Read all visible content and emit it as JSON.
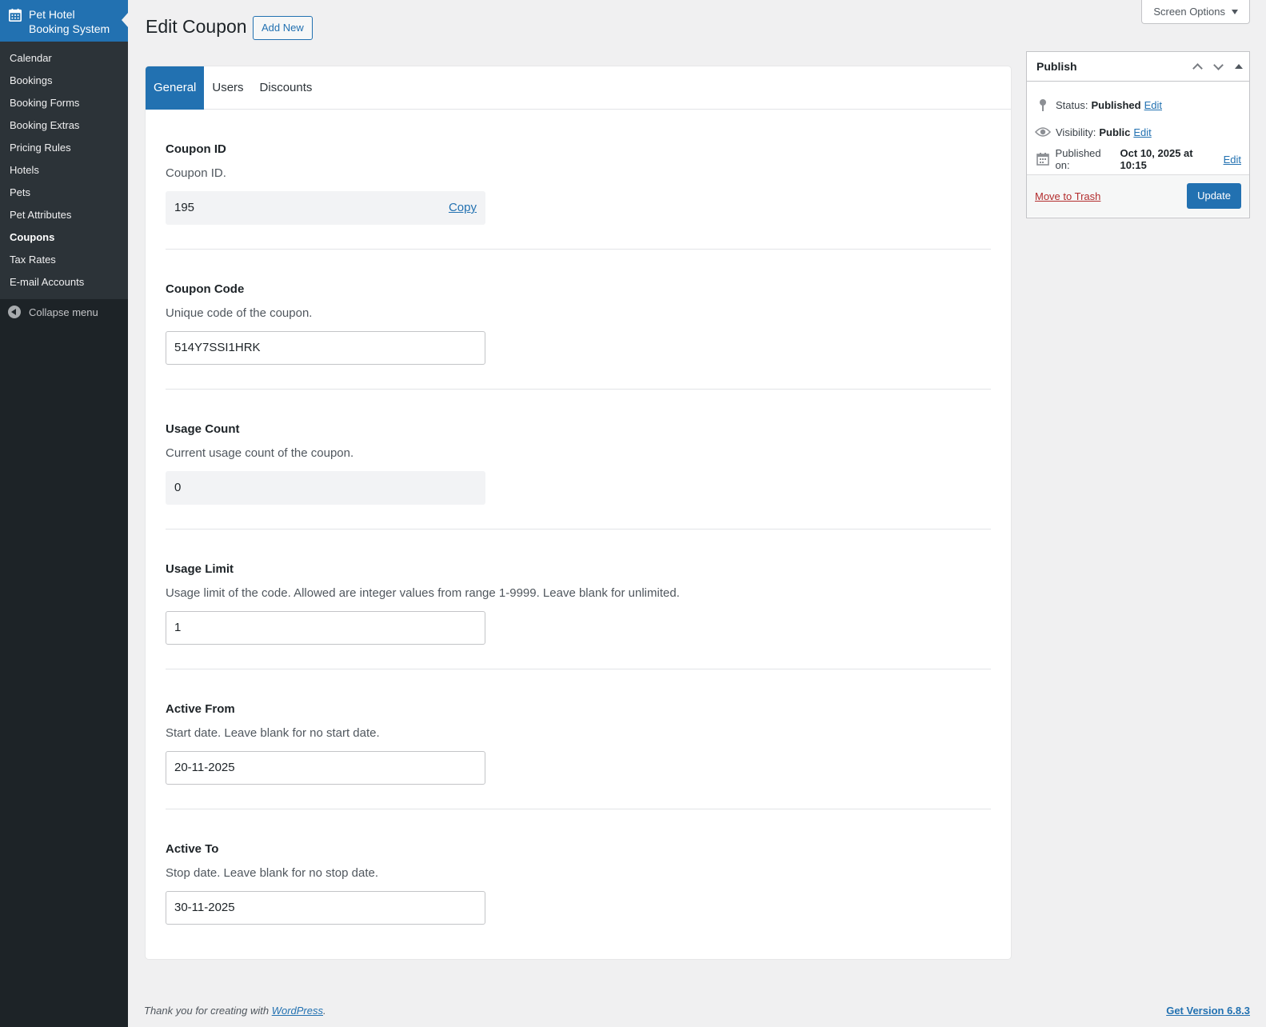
{
  "sidebar": {
    "app_title_line1": "Pet Hotel",
    "app_title_line2": "Booking System",
    "app_icon": "calendar-icon",
    "items": [
      {
        "label": "Calendar"
      },
      {
        "label": "Bookings"
      },
      {
        "label": "Booking Forms"
      },
      {
        "label": "Booking Extras"
      },
      {
        "label": "Pricing Rules"
      },
      {
        "label": "Hotels"
      },
      {
        "label": "Pets"
      },
      {
        "label": "Pet Attributes"
      },
      {
        "label": "Coupons",
        "current": true
      },
      {
        "label": "Tax Rates"
      },
      {
        "label": "E-mail Accounts"
      }
    ],
    "collapse_label": "Collapse menu"
  },
  "header": {
    "screen_options": "Screen Options",
    "title": "Edit Coupon",
    "add_new": "Add New"
  },
  "tabs": [
    {
      "label": "General",
      "active": true
    },
    {
      "label": "Users"
    },
    {
      "label": "Discounts"
    }
  ],
  "fields": {
    "coupon_id": {
      "label": "Coupon ID",
      "desc": "Coupon ID.",
      "value": "195",
      "copy": "Copy"
    },
    "coupon_code": {
      "label": "Coupon Code",
      "desc": "Unique code of the coupon.",
      "value": "514Y7SSI1HRK"
    },
    "usage_count": {
      "label": "Usage Count",
      "desc": "Current usage count of the coupon.",
      "value": "0"
    },
    "usage_limit": {
      "label": "Usage Limit",
      "desc": "Usage limit of the code. Allowed are integer values from range 1-9999. Leave blank for unlimited.",
      "value": "1"
    },
    "active_from": {
      "label": "Active From",
      "desc": "Start date. Leave blank for no start date.",
      "value": "20-11-2025"
    },
    "active_to": {
      "label": "Active To",
      "desc": "Stop date. Leave blank for no stop date.",
      "value": "30-11-2025"
    }
  },
  "publish": {
    "title": "Publish",
    "status_label": "Status:",
    "status_value": "Published",
    "visibility_label": "Visibility:",
    "visibility_value": "Public",
    "published_label": "Published on:",
    "published_value": "Oct 10, 2025 at 10:15",
    "edit": "Edit",
    "trash": "Move to Trash",
    "update": "Update"
  },
  "footer": {
    "thanks_prefix": "Thank you for creating with ",
    "wordpress": "WordPress",
    "thanks_suffix": ".",
    "version": "Get Version 6.8.3"
  },
  "colors": {
    "accent": "#2271b1",
    "sidebar_bg": "#1d2327",
    "danger": "#b32d2e"
  }
}
